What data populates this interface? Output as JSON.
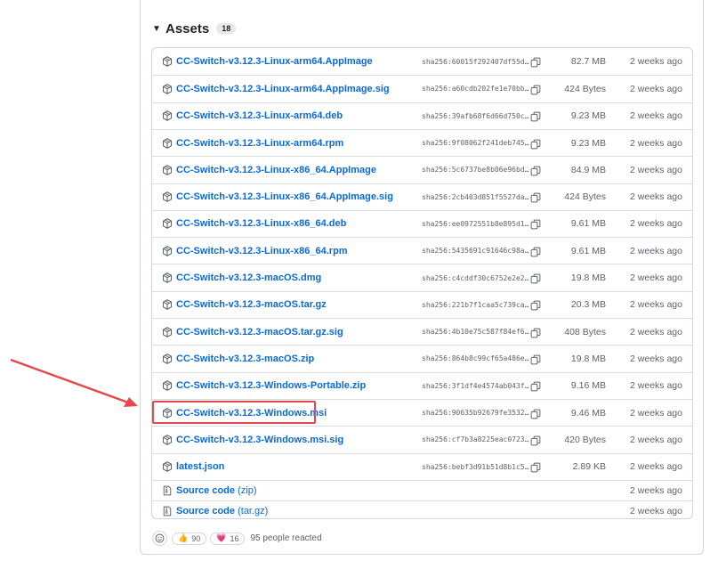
{
  "assets": {
    "title": "Assets",
    "count": "18",
    "caret": "▼",
    "rows": [
      {
        "name": "CC-Switch-v3.12.3-Linux-arm64.AppImage",
        "sha": "sha256:60015f292407df55d…",
        "size": "82.7 MB",
        "date": "2 weeks ago",
        "icon": "package-icon"
      },
      {
        "name": "CC-Switch-v3.12.3-Linux-arm64.AppImage.sig",
        "sha": "sha256:a60cdb202fe1e70bb…",
        "size": "424 Bytes",
        "date": "2 weeks ago",
        "icon": "package-icon"
      },
      {
        "name": "CC-Switch-v3.12.3-Linux-arm64.deb",
        "sha": "sha256:39afb68f6d66d750c…",
        "size": "9.23 MB",
        "date": "2 weeks ago",
        "icon": "package-icon"
      },
      {
        "name": "CC-Switch-v3.12.3-Linux-arm64.rpm",
        "sha": "sha256:9f08062f241deb745…",
        "size": "9.23 MB",
        "date": "2 weeks ago",
        "icon": "package-icon"
      },
      {
        "name": "CC-Switch-v3.12.3-Linux-x86_64.AppImage",
        "sha": "sha256:5c6737be8b06e96bd…",
        "size": "84.9 MB",
        "date": "2 weeks ago",
        "icon": "package-icon"
      },
      {
        "name": "CC-Switch-v3.12.3-Linux-x86_64.AppImage.sig",
        "sha": "sha256:2cb403d851f5527da…",
        "size": "424 Bytes",
        "date": "2 weeks ago",
        "icon": "package-icon"
      },
      {
        "name": "CC-Switch-v3.12.3-Linux-x86_64.deb",
        "sha": "sha256:ee0972551b8e895d1…",
        "size": "9.61 MB",
        "date": "2 weeks ago",
        "icon": "package-icon"
      },
      {
        "name": "CC-Switch-v3.12.3-Linux-x86_64.rpm",
        "sha": "sha256:5435691c91646c98a…",
        "size": "9.61 MB",
        "date": "2 weeks ago",
        "icon": "package-icon"
      },
      {
        "name": "CC-Switch-v3.12.3-macOS.dmg",
        "sha": "sha256:c4cddf30c6752e2e2…",
        "size": "19.8 MB",
        "date": "2 weeks ago",
        "icon": "package-icon"
      },
      {
        "name": "CC-Switch-v3.12.3-macOS.tar.gz",
        "sha": "sha256:221b7f1caa5c739ca…",
        "size": "20.3 MB",
        "date": "2 weeks ago",
        "icon": "package-icon"
      },
      {
        "name": "CC-Switch-v3.12.3-macOS.tar.gz.sig",
        "sha": "sha256:4b10e75c587f84ef6…",
        "size": "408 Bytes",
        "date": "2 weeks ago",
        "icon": "package-icon"
      },
      {
        "name": "CC-Switch-v3.12.3-macOS.zip",
        "sha": "sha256:864b8c99cf65a486e…",
        "size": "19.8 MB",
        "date": "2 weeks ago",
        "icon": "package-icon"
      },
      {
        "name": "CC-Switch-v3.12.3-Windows-Portable.zip",
        "sha": "sha256:3f1df4e4574ab043f…",
        "size": "9.16 MB",
        "date": "2 weeks ago",
        "icon": "package-icon"
      },
      {
        "name": "CC-Switch-v3.12.3-Windows.msi",
        "sha": "sha256:90635b92679fe3532…",
        "size": "9.46 MB",
        "date": "2 weeks ago",
        "icon": "package-icon"
      },
      {
        "name": "CC-Switch-v3.12.3-Windows.msi.sig",
        "sha": "sha256:cf7b3a8225eac0723…",
        "size": "420 Bytes",
        "date": "2 weeks ago",
        "icon": "package-icon"
      },
      {
        "name": "latest.json",
        "sha": "sha256:bebf3d91b51d8b1c5…",
        "size": "2.89 KB",
        "date": "2 weeks ago",
        "icon": "package-icon"
      }
    ],
    "source_rows": [
      {
        "name": "Source code",
        "suffix": "(zip)",
        "date": "2 weeks ago",
        "icon": "file-zip-icon"
      },
      {
        "name": "Source code",
        "suffix": "(tar.gz)",
        "date": "2 weeks ago",
        "icon": "file-zip-icon"
      }
    ]
  },
  "reactions": {
    "thumbs_emoji": "👍",
    "thumbs_count": "90",
    "heart_emoji": "💗",
    "heart_count": "16",
    "summary": "95 people reacted"
  },
  "colors": {
    "link": "#0969da",
    "muted": "#59636e",
    "highlight": "#e5484d",
    "arrow": "#e5484d"
  }
}
